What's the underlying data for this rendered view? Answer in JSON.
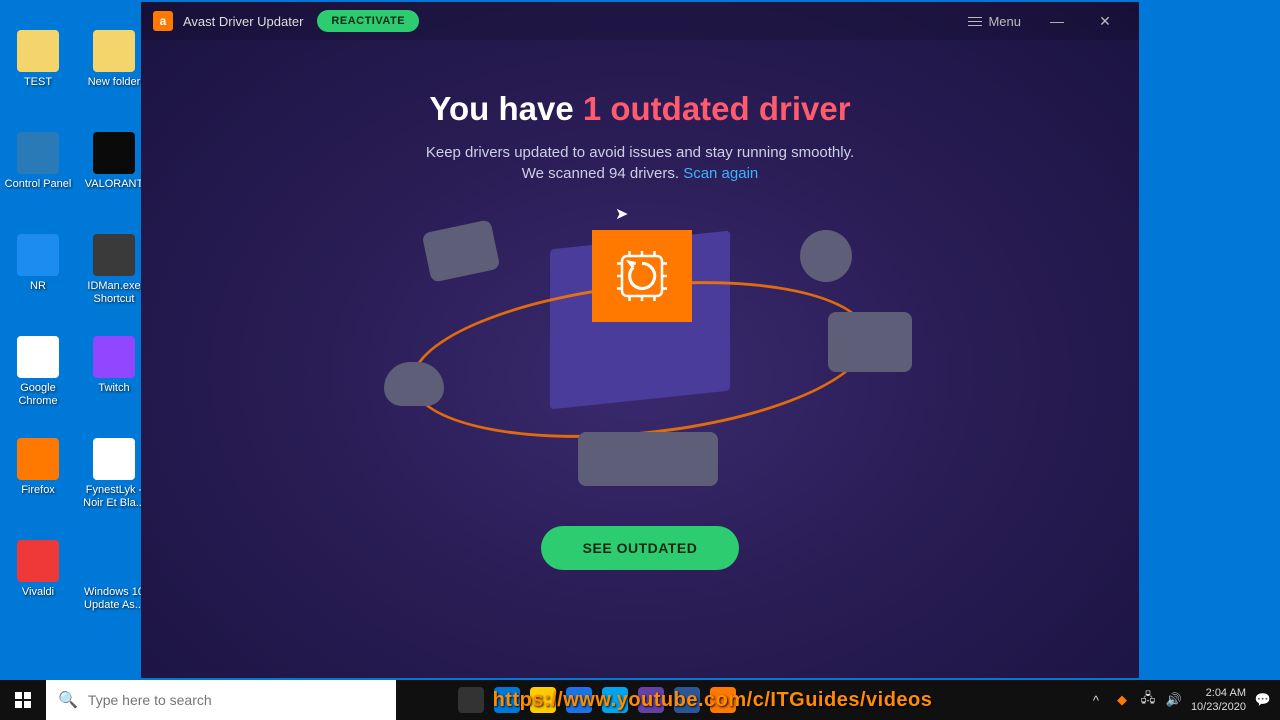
{
  "desktop": {
    "icons": [
      {
        "label": "TEST",
        "bg": "#f4d56b"
      },
      {
        "label": "New folder",
        "bg": "#f4d56b"
      },
      {
        "label": "Control Panel",
        "bg": "#2a7ab8"
      },
      {
        "label": "VALORANT",
        "bg": "#0a0a0a"
      },
      {
        "label": "NR",
        "bg": "#1d8cf0"
      },
      {
        "label": "IDMan.exe Shortcut",
        "bg": "#3a3a3a"
      },
      {
        "label": "Google Chrome",
        "bg": "#ffffff"
      },
      {
        "label": "Twitch",
        "bg": "#9146ff"
      },
      {
        "label": "Firefox",
        "bg": "#ff7800"
      },
      {
        "label": "FynestLyk - Noir Et Bla...",
        "bg": "#ffffff"
      },
      {
        "label": "Vivaldi",
        "bg": "#ef3939"
      },
      {
        "label": "Windows 10 Update As...",
        "bg": "#0078d7"
      }
    ]
  },
  "app": {
    "title": "Avast Driver Updater",
    "reactivate": "REACTIVATE",
    "menu": "Menu",
    "headline_prefix": "You have ",
    "headline_accent": "1 outdated driver",
    "subtitle": "Keep drivers updated to avoid issues and stay running smoothly.",
    "scanned_prefix": "We scanned 94 drivers. ",
    "scan_again": "Scan again",
    "cta": "SEE OUTDATED"
  },
  "taskbar": {
    "search_placeholder": "Type here to search",
    "url_overlay": "https://www.youtube.com/c/ITGuides/videos",
    "time": "2:04 AM",
    "date": "10/23/2020"
  }
}
